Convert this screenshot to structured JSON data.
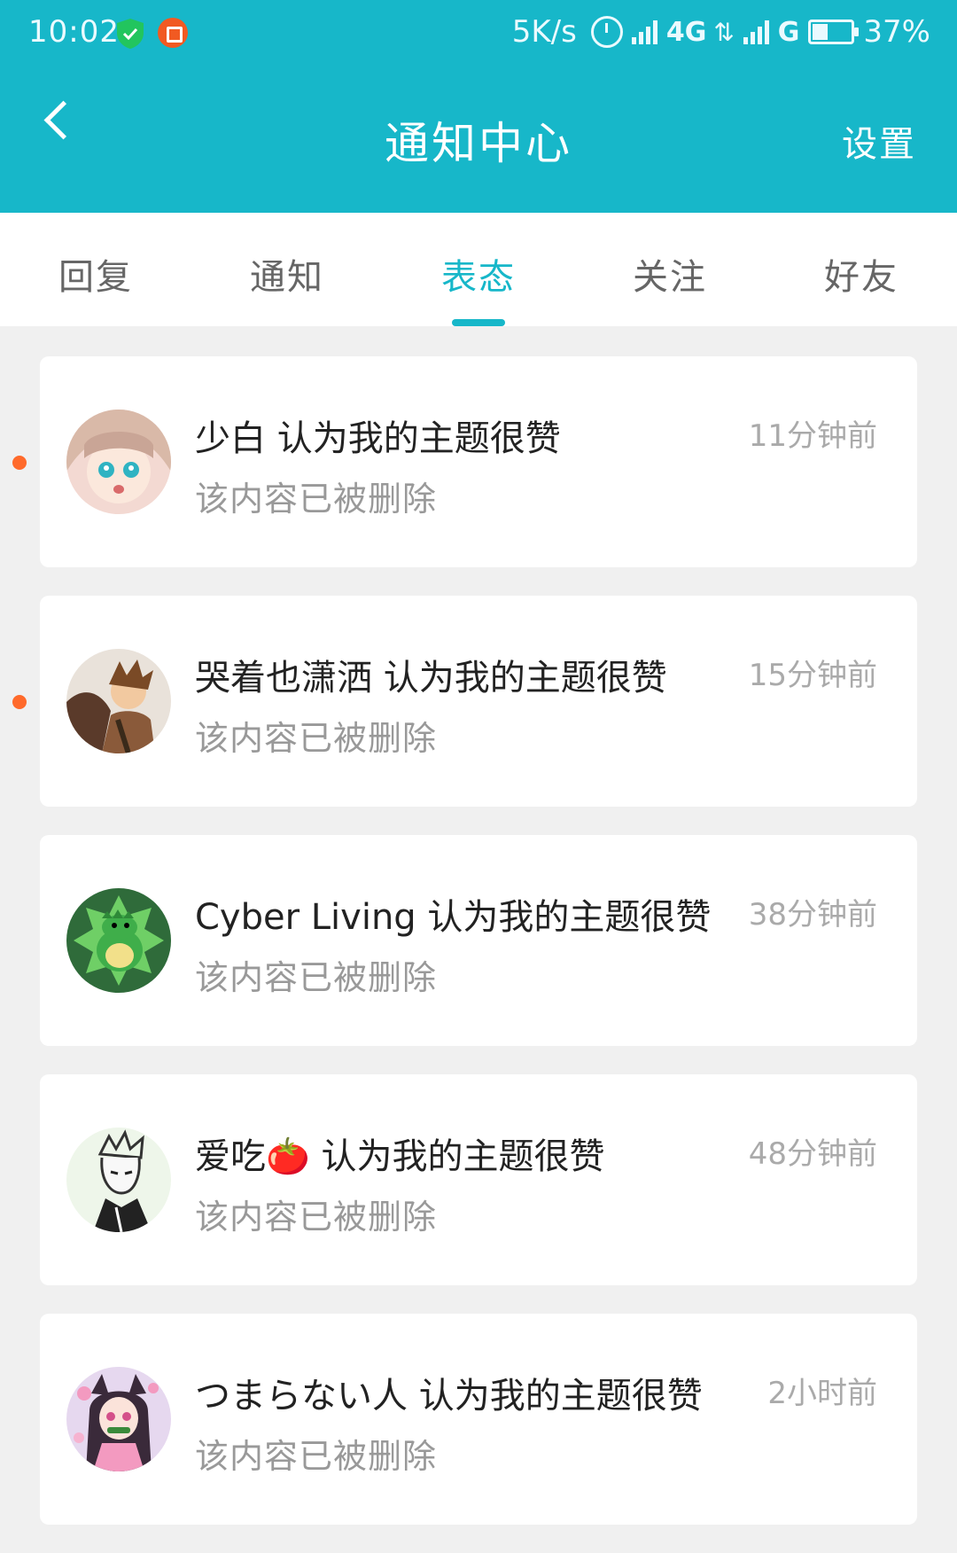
{
  "status_bar": {
    "time": "10:02",
    "net_speed": "5K/s",
    "network_1": "4G",
    "network_2": "G",
    "battery": "37%",
    "battery_level": 0.37,
    "icons": [
      "shield-check-icon",
      "app-badge-icon",
      "alarm-icon",
      "signal-icon",
      "data-arrows-icon",
      "battery-icon"
    ]
  },
  "header": {
    "back_icon": "chevron-left-icon",
    "title": "通知中心",
    "settings_label": "设置",
    "bg_color": "#17b7c9"
  },
  "tabs": [
    {
      "label": "回复",
      "active": false
    },
    {
      "label": "通知",
      "active": false
    },
    {
      "label": "表态",
      "active": true
    },
    {
      "label": "关注",
      "active": false
    },
    {
      "label": "好友",
      "active": false
    }
  ],
  "colors": {
    "accent": "#17b7c9",
    "unread": "#ff6a2b",
    "background": "#f0f0f0"
  },
  "notifications": [
    {
      "title": "少白 认为我的主题很赞",
      "time": "11分钟前",
      "subtitle": "该内容已被删除",
      "unread": true,
      "avatar": "anime-girl-avatar"
    },
    {
      "title": "哭着也潇洒 认为我的主题很赞",
      "time": "15分钟前",
      "subtitle": "该内容已被删除",
      "unread": true,
      "avatar": "warrior-avatar"
    },
    {
      "title": "Cyber Living 认为我的主题很赞",
      "time": "38分钟前",
      "subtitle": "该内容已被删除",
      "unread": false,
      "avatar": "dinosaur-avatar"
    },
    {
      "title": "爱吃🍅 认为我的主题很赞",
      "time": "48分钟前",
      "subtitle": "该内容已被删除",
      "unread": false,
      "avatar": "sketch-character-avatar"
    },
    {
      "title": "つまらない人 认为我的主题很赞",
      "time": "2小时前",
      "subtitle": "该内容已被删除",
      "unread": false,
      "avatar": "demon-girl-avatar"
    }
  ]
}
